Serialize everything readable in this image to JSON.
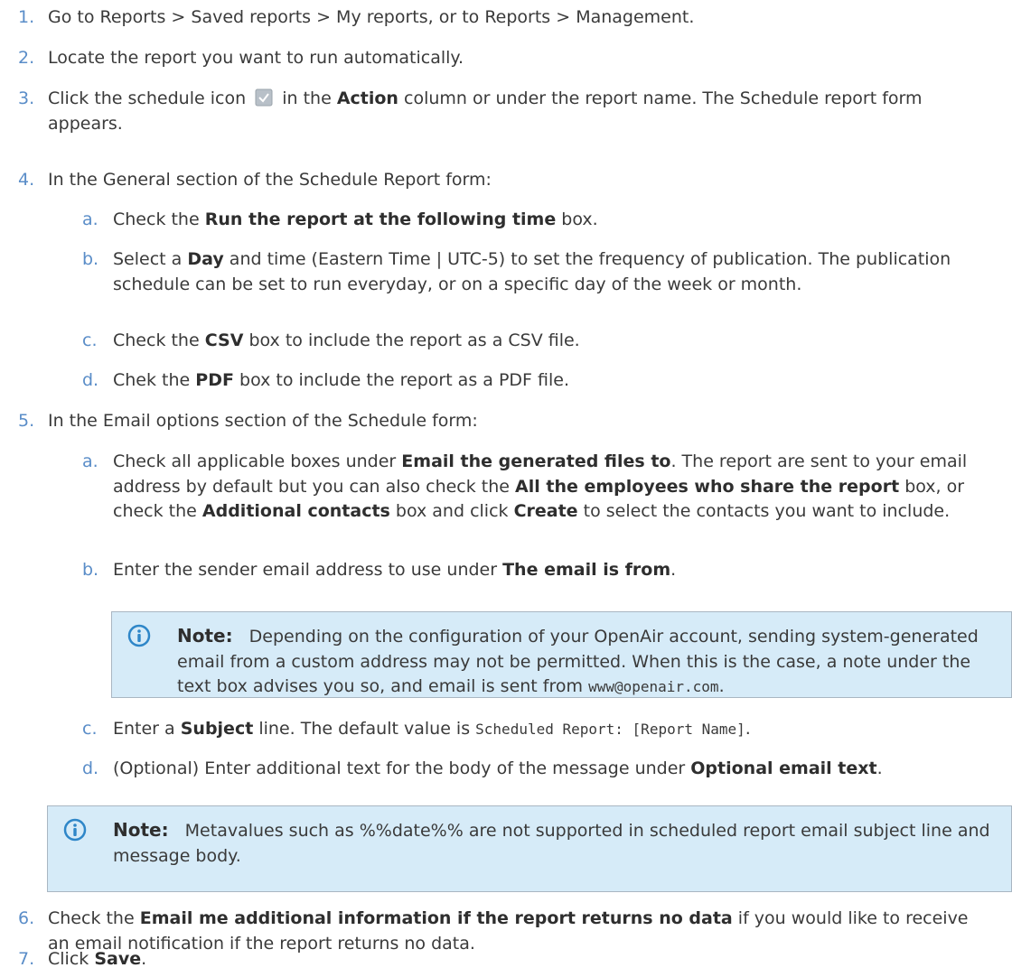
{
  "steps": [
    {
      "num": "1.",
      "text": "Go to Reports > Saved reports > My reports, or to Reports > Management."
    },
    {
      "num": "2.",
      "text": "Locate the report you want to run automatically."
    },
    {
      "num": "3.",
      "a": "Click the schedule icon",
      "b": "in the",
      "bold1": "Action",
      "c": "column or under the report name. The Schedule report form appears."
    },
    {
      "num": "4.",
      "text": "In the General section of the Schedule Report form:"
    },
    {
      "num": "5.",
      "text": "In the Email options section of the Schedule form:"
    },
    {
      "num": "6.",
      "a": "Check the",
      "bold1": "Email me additional information if the report returns no data",
      "b": "if you would like to receive an email notification if the report returns no data."
    },
    {
      "num": "7.",
      "a": "Click",
      "bold1": "Save",
      "b": "."
    }
  ],
  "general": [
    {
      "l": "a.",
      "a": "Check the",
      "bold1": "Run the report at the following time",
      "b": "box."
    },
    {
      "l": "b.",
      "a": "Select a",
      "bold1": "Day",
      "b": "and time (Eastern Time | UTC-5) to set the frequency of publication. The publication schedule can be set to run everyday, or on a specific day of the week or month."
    },
    {
      "l": "c.",
      "a": "Check the",
      "bold1": "CSV",
      "b": "box to include the report as a CSV file."
    },
    {
      "l": "d.",
      "a": "Chek the",
      "bold1": "PDF",
      "b": "box to include the report as a PDF file."
    }
  ],
  "email": [
    {
      "l": "a.",
      "a": "Check all applicable boxes under",
      "bold1": "Email the generated files to",
      "b": ". The report are sent to your email address by default but you can also check the",
      "bold2": "All the employees who share the report",
      "c": "box, or check the",
      "bold3": "Additional contacts",
      "d": "box and click",
      "bold4": "Create",
      "e": "to select the contacts you want to include."
    },
    {
      "l": "b.",
      "a": "Enter the sender email address to use under",
      "bold1": "The email is from",
      "b": "."
    },
    {
      "l": "c.",
      "a": "Enter a",
      "bold1": "Subject",
      "b": "line. The default value is",
      "code": "Scheduled Report: [Report Name]",
      "c": "."
    },
    {
      "l": "d.",
      "a": "(Optional) Enter additional text for the body of the message under",
      "bold1": "Optional email text",
      "b": "."
    }
  ],
  "note1": {
    "label": "Note:",
    "text": "Depending on the configuration of your OpenAir account, sending system-generated email from a custom address may not be permitted. When this is the case, a note under the text box advises you so, and email is sent from",
    "code": "www@openair.com",
    "end": "."
  },
  "note2": {
    "label": "Note:",
    "text": "Metavalues such as %%date%% are not supported in scheduled report email subject line and message body."
  },
  "colors": {
    "accent": "#5a8dc8",
    "note_bg": "#d6ebf8",
    "icon": "#2e86c8"
  }
}
